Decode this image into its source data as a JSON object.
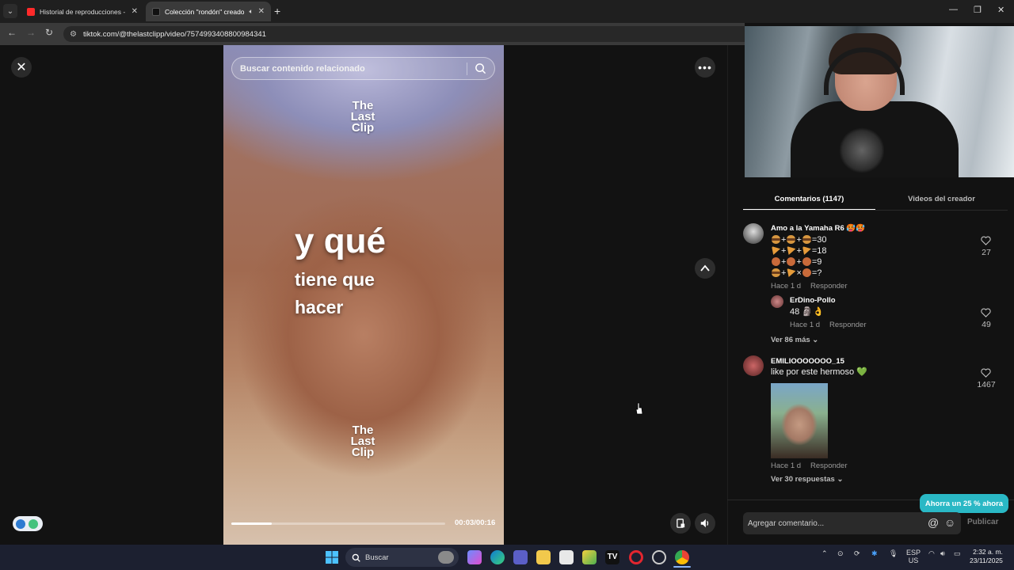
{
  "browser": {
    "tabs": [
      {
        "title": "Historial de reproducciones - Y",
        "active": false,
        "favicon_color": "#ff2a2a"
      },
      {
        "title": "Colección \"rondón\" creado",
        "active": true,
        "favicon_color": "#111111"
      }
    ],
    "url": "tiktok.com/@thelastclipp/video/7574993408800984341"
  },
  "video": {
    "search_placeholder": "Buscar contenido relacionado",
    "logo_top": [
      "The",
      "Last",
      "Clip"
    ],
    "logo_bottom": [
      "The",
      "Last",
      "Clip"
    ],
    "caption_big": "y qué",
    "caption_line2": "tiene que",
    "caption_line3": "hacer",
    "timecode": "00:03/00:16",
    "progress_fraction": 0.1875
  },
  "comments_panel": {
    "tabs": [
      "Comentarios (1147)",
      "Videos del creador"
    ],
    "comments": [
      {
        "user": "Amo a la Yamaha R6 🥵🥵",
        "lines": [
          "=30",
          "=18",
          "=9",
          "=?"
        ],
        "time": "Hace 1 d",
        "reply_label": "Responder",
        "likes": "27"
      },
      {
        "user": "ErDino-Pollo",
        "text": "48 🗿👌",
        "time": "Hace 1 d",
        "reply_label": "Responder",
        "likes": "49"
      },
      {
        "user": "EMILIOOOOOOO_15",
        "text": "like por este hermoso 💚",
        "time": "Hace 1 d",
        "reply_label": "Responder",
        "likes": "1467"
      }
    ],
    "more_replies_1": "Ver 86 más",
    "more_replies_2": "Ver 30 respuestas",
    "promo": "Ahorra un 25 % ahora",
    "input_placeholder": "Agregar comentario...",
    "publish_label": "Publicar"
  },
  "taskbar": {
    "search_label": "Buscar",
    "lang_1": "ESP",
    "lang_2": "US",
    "time": "2:32 a. m.",
    "date": "23/11/2025"
  },
  "colors": {
    "accent_promo": "#2ab8c5",
    "like_green": "#3ecf6a"
  }
}
